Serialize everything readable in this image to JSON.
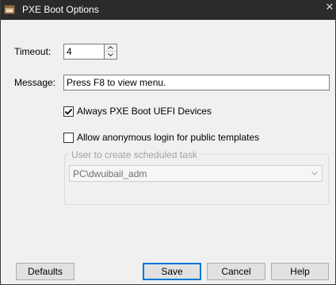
{
  "window": {
    "title": "PXE Boot Options",
    "close_glyph": "✕"
  },
  "timeout": {
    "label": "Timeout:",
    "value": "4"
  },
  "message": {
    "label": "Message:",
    "value": "Press F8 to view menu."
  },
  "always_pxe": {
    "label": "Always PXE Boot UEFI Devices",
    "checked": true
  },
  "anonymous_login": {
    "label": "Allow anonymous login for public templates",
    "checked": false
  },
  "scheduled_task": {
    "group_label": "User to create scheduled task",
    "selected": "PC\\dwuibail_adm",
    "enabled": false
  },
  "buttons": {
    "defaults": "Defaults",
    "save": "Save",
    "cancel": "Cancel",
    "help": "Help"
  },
  "icons": {
    "app": "app-window-icon",
    "close": "close-icon",
    "spin_up": "chevron-up-icon",
    "spin_down": "chevron-down-icon",
    "combo": "chevron-down-icon",
    "check": "checkmark-icon"
  },
  "colors": {
    "titlebar": "#2b2b2b",
    "default_button_border": "#0078d7",
    "window_bg": "#f0f0f0"
  }
}
